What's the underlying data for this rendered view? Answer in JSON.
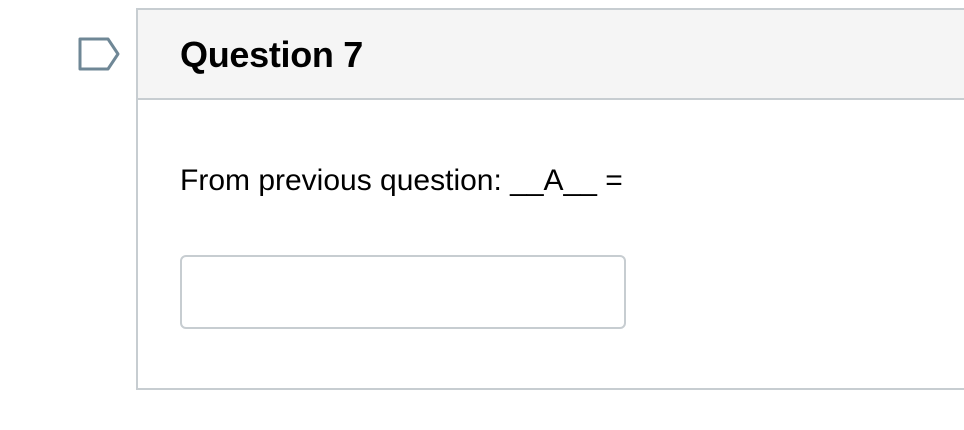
{
  "flag": {
    "icon": "flag-question-icon",
    "color": "#6f8796"
  },
  "question": {
    "title": "Question 7",
    "text": "From previous question: __A__ =",
    "answer_value": "",
    "answer_placeholder": ""
  },
  "colors": {
    "header_bg": "#f5f5f5",
    "border": "#c7cdd1",
    "text": "#000000"
  }
}
